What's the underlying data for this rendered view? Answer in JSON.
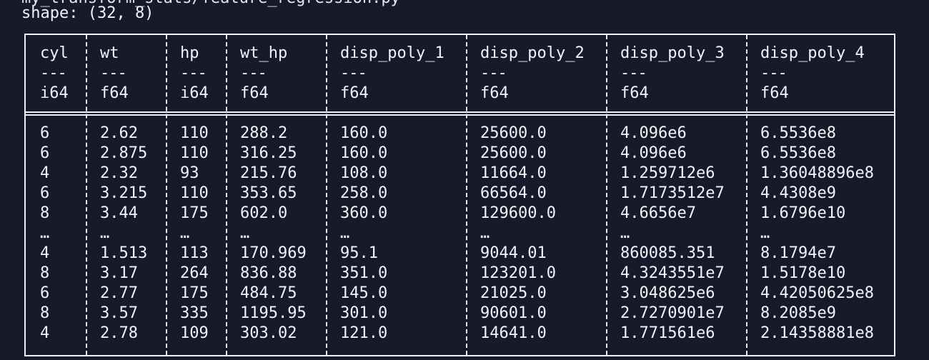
{
  "terminal": {
    "top_line": "my_transform_stats/feature_regression.py",
    "shape_text": "shape: (32, 8)"
  },
  "table": {
    "columns": [
      {
        "name": "cyl",
        "sep": "---",
        "dtype": "i64"
      },
      {
        "name": "wt",
        "sep": "---",
        "dtype": "f64"
      },
      {
        "name": "hp",
        "sep": "---",
        "dtype": "i64"
      },
      {
        "name": "wt_hp",
        "sep": "---",
        "dtype": "f64"
      },
      {
        "name": "disp_poly_1",
        "sep": "---",
        "dtype": "f64"
      },
      {
        "name": "disp_poly_2",
        "sep": "---",
        "dtype": "f64"
      },
      {
        "name": "disp_poly_3",
        "sep": "---",
        "dtype": "f64"
      },
      {
        "name": "disp_poly_4",
        "sep": "---",
        "dtype": "f64"
      }
    ],
    "rows": [
      [
        "6",
        "2.62",
        "110",
        "288.2",
        "160.0",
        "25600.0",
        "4.096e6",
        "6.5536e8"
      ],
      [
        "6",
        "2.875",
        "110",
        "316.25",
        "160.0",
        "25600.0",
        "4.096e6",
        "6.5536e8"
      ],
      [
        "4",
        "2.32",
        "93",
        "215.76",
        "108.0",
        "11664.0",
        "1.259712e6",
        "1.36048896e8"
      ],
      [
        "6",
        "3.215",
        "110",
        "353.65",
        "258.0",
        "66564.0",
        "1.7173512e7",
        "4.4308e9"
      ],
      [
        "8",
        "3.44",
        "175",
        "602.0",
        "360.0",
        "129600.0",
        "4.6656e7",
        "1.6796e10"
      ],
      [
        "…",
        "…",
        "…",
        "…",
        "…",
        "…",
        "…",
        "…"
      ],
      [
        "4",
        "1.513",
        "113",
        "170.969",
        "95.1",
        "9044.01",
        "860085.351",
        "8.1794e7"
      ],
      [
        "8",
        "3.17",
        "264",
        "836.88",
        "351.0",
        "123201.0",
        "4.3243551e7",
        "1.5178e10"
      ],
      [
        "6",
        "2.77",
        "175",
        "484.75",
        "145.0",
        "21025.0",
        "3.048625e6",
        "4.42050625e8"
      ],
      [
        "8",
        "3.57",
        "335",
        "1195.95",
        "301.0",
        "90601.0",
        "2.7270901e7",
        "8.2085e9"
      ],
      [
        "4",
        "2.78",
        "109",
        "303.02",
        "121.0",
        "14641.0",
        "1.771561e6",
        "2.14358881e8"
      ]
    ]
  }
}
